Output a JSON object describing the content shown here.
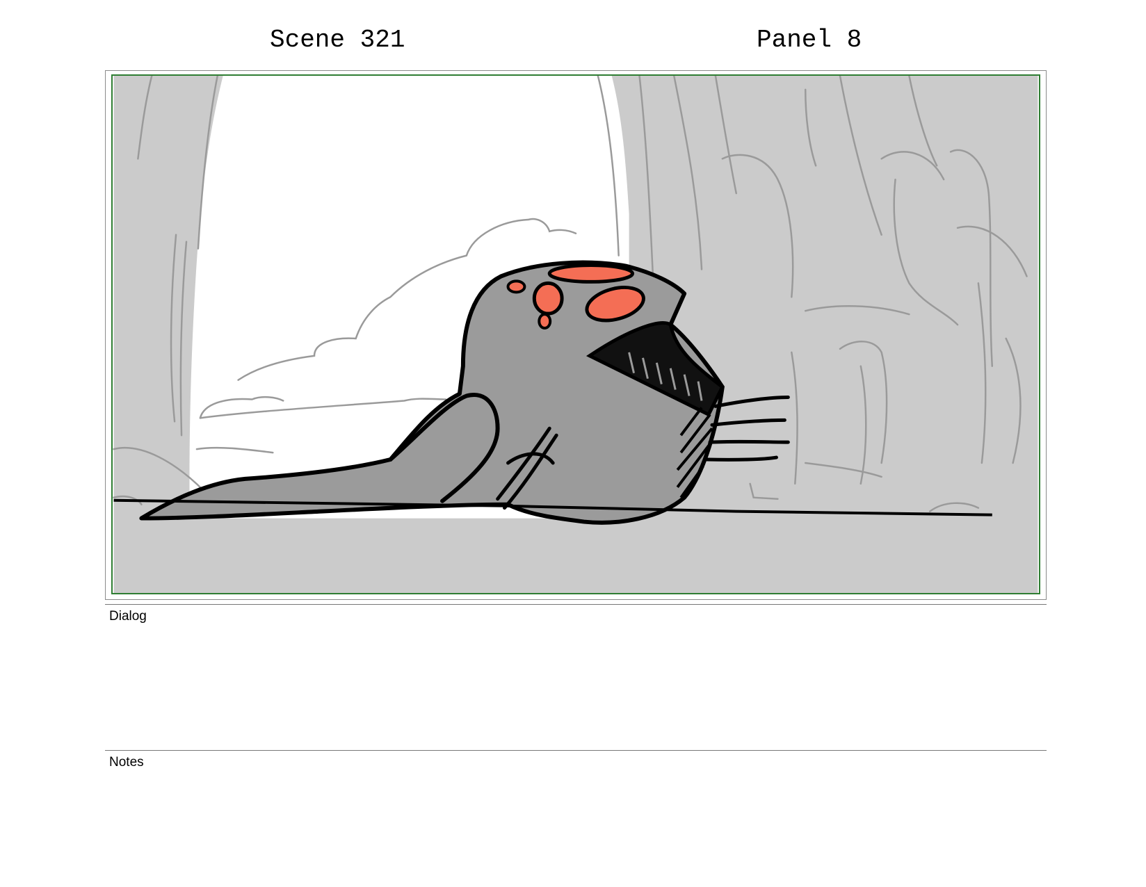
{
  "header": {
    "scene_label": "Scene 321",
    "panel_label": "Panel 8"
  },
  "panel": {
    "frame_color": "#2e7d32",
    "background_color": "#cbcbcb",
    "sky_color": "#ffffff",
    "creature_color": "#9b9b9b",
    "accent_color": "#f46e55"
  },
  "sections": {
    "dialog": {
      "label": "Dialog",
      "text": ""
    },
    "notes": {
      "label": "Notes",
      "text": ""
    }
  }
}
